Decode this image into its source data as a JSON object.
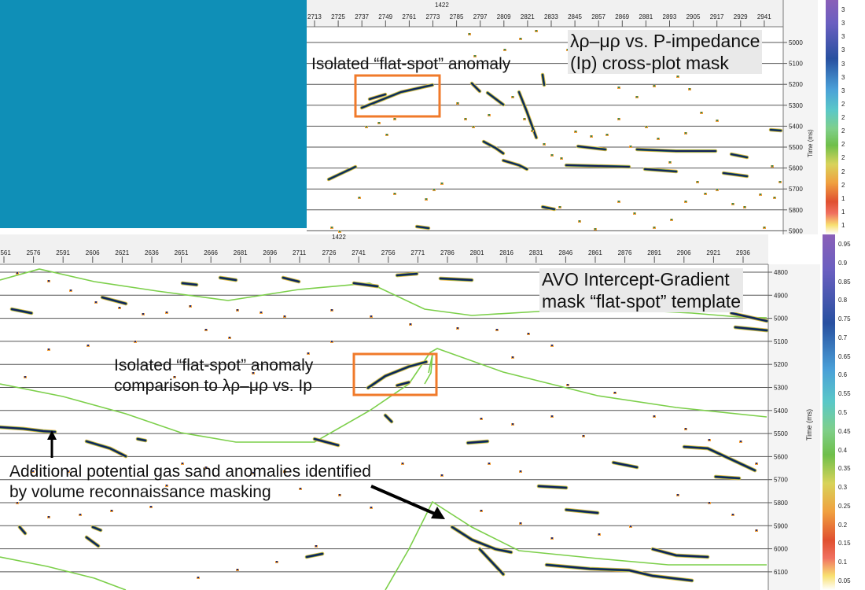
{
  "top_panel": {
    "title_marker": "1422",
    "x_ticks": [
      "2713",
      "2725",
      "2737",
      "2749",
      "2761",
      "2773",
      "2785",
      "2797",
      "2809",
      "2821",
      "2833",
      "2845",
      "2857",
      "2869",
      "2881",
      "2893",
      "2905",
      "2917",
      "2929",
      "2941"
    ],
    "time_ticks": [
      "5000",
      "5100",
      "5200",
      "5300",
      "5400",
      "5500",
      "5600",
      "5700",
      "5800",
      "5900"
    ],
    "time_axis_label": "Time (ms)",
    "label_line1": "λρ–μρ vs. P-impedance",
    "label_line2": "(Ip) cross-plot mask",
    "callout": "Isolated “flat-spot” anomaly",
    "colorbar_ticks": [
      "3",
      "3",
      "3",
      "3",
      "3",
      "3",
      "3",
      "2",
      "2",
      "2",
      "2",
      "2",
      "2",
      "2",
      "1",
      "1",
      "1"
    ]
  },
  "bottom_panel": {
    "title_marker": "1422",
    "x_ticks": [
      "2561",
      "2576",
      "2591",
      "2606",
      "2621",
      "2636",
      "2651",
      "2666",
      "2681",
      "2696",
      "2711",
      "2726",
      "2741",
      "2756",
      "2771",
      "2786",
      "2801",
      "2816",
      "2831",
      "2846",
      "2861",
      "2876",
      "2891",
      "2906",
      "2921",
      "2936"
    ],
    "time_ticks": [
      "4800",
      "4900",
      "5000",
      "5100",
      "5200",
      "5300",
      "5400",
      "5500",
      "5600",
      "5700",
      "5800",
      "5900",
      "6000",
      "6100"
    ],
    "time_axis_label": "Time (ms)",
    "label_line1": "AVO Intercept-Gradient",
    "label_line2": "mask “flat-spot” template",
    "callout_line1": "Isolated “flat-spot” anomaly",
    "callout_line2": "comparison to λρ–μρ vs. Ip",
    "annotation_line1": "Additional potential gas sand anomalies identified",
    "annotation_line2": "by volume reconnaissance masking",
    "colorbar_ticks": [
      "0.95",
      "0.9",
      "0.85",
      "0.8",
      "0.75",
      "0.7",
      "0.65",
      "0.6",
      "0.55",
      "0.5",
      "0.45",
      "0.4",
      "0.35",
      "0.3",
      "0.25",
      "0.2",
      "0.15",
      "0.1",
      "0.05"
    ]
  },
  "colors": {
    "background_teal": "#0f8fb7",
    "highlight_box": "#f07a2a",
    "horizon": "#7ccf4a",
    "arrow": "#000000"
  }
}
